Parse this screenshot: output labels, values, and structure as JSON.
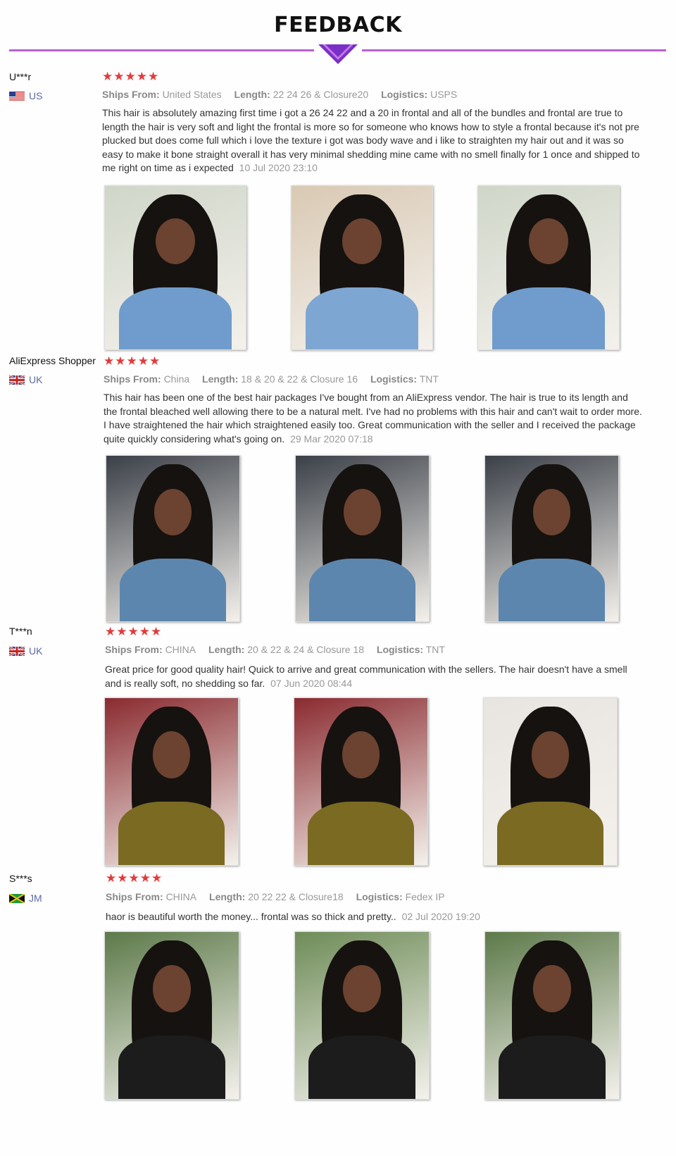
{
  "header": {
    "title": "FEEDBACK",
    "accent_color": "#b760d6",
    "arrow_color": "#7b2fc9"
  },
  "reviews": [
    {
      "user": "U***r",
      "country": "US",
      "flag": "us-flag-icon",
      "stars": "★★★★★",
      "ships_from_label": "Ships From:",
      "ships_from": "United States",
      "length_label": "Length:",
      "length": "22 24 26 & Closure20",
      "logistics_label": "Logistics:",
      "logistics": "USPS",
      "text": "This hair is absolutely amazing first time i got a 26 24 22 and a 20 in frontal and all of the bundles and frontal are true to length the hair is very soft and light the frontal is more so for someone who knows how to style a frontal because it's not pre plucked but does come full which i love the texture i got was body wave and i like to straighten my hair out and it was so easy to make it bone straight overall it has very minimal shedding mine came with no smell finally for 1 once and shipped to me right on time as i expected",
      "date": "10 Jul 2020 23:10",
      "photos": [
        {
          "icon": "customer-photo-icon",
          "bg": "#cfd6c8",
          "shirt": "#6f9ccc"
        },
        {
          "icon": "customer-photo-icon",
          "bg": "#d9c9b4",
          "shirt": "#7ea6d2"
        },
        {
          "icon": "customer-photo-icon",
          "bg": "#cfd6c8",
          "shirt": "#6f9ccc"
        }
      ]
    },
    {
      "user": "AliExpress Shopper",
      "country": "UK",
      "flag": "uk-flag-icon",
      "stars": "★★★★★",
      "ships_from_label": "Ships From:",
      "ships_from": "China",
      "length_label": "Length:",
      "length": "18 & 20 & 22 & Closure 16",
      "logistics_label": "Logistics:",
      "logistics": "TNT",
      "text": "This hair has been one of the best hair packages I've bought from an AliExpress vendor. The hair is true to its length and the frontal bleached well allowing there to be a natural melt. I've had no problems with this hair and can't wait to order more. I have straightened the hair which straightened easily too. Great communication with the seller and I received the package quite quickly considering what's going on.",
      "date": "29 Mar 2020 07:18",
      "photos": [
        {
          "icon": "customer-photo-icon",
          "bg": "#3b4048",
          "shirt": "#5c86ad"
        },
        {
          "icon": "customer-photo-icon",
          "bg": "#3b4048",
          "shirt": "#5c86ad"
        },
        {
          "icon": "customer-photo-icon",
          "bg": "#3b4048",
          "shirt": "#5c86ad"
        }
      ]
    },
    {
      "user": "T***n",
      "country": "UK",
      "flag": "uk-flag-icon",
      "stars": "★★★★★",
      "ships_from_label": "Ships From:",
      "ships_from": "CHINA",
      "length_label": "Length:",
      "length": "20 & 22 & 24 & Closure 18",
      "logistics_label": "Logistics:",
      "logistics": "TNT",
      "text": "Great price for good quality hair! Quick to arrive and great communication with the sellers. The hair doesn't have a smell and is really soft, no shedding so far.",
      "date": "07 Jun 2020 08:44",
      "photos": [
        {
          "icon": "customer-photo-icon",
          "bg": "#8a2b30",
          "shirt": "#7a6a22"
        },
        {
          "icon": "customer-photo-icon",
          "bg": "#8a2b30",
          "shirt": "#7a6a22"
        },
        {
          "icon": "customer-photo-icon",
          "bg": "#e8e4e0",
          "shirt": "#7a6a22"
        }
      ]
    },
    {
      "user": "S***s",
      "country": "JM",
      "flag": "jm-flag-icon",
      "stars": "★★★★★",
      "ships_from_label": "Ships From:",
      "ships_from": "CHINA",
      "length_label": "Length:",
      "length": "20 22 22 & Closure18",
      "logistics_label": "Logistics:",
      "logistics": "Fedex IP",
      "text": "haor is beautiful worth the money... frontal was so thick and pretty..",
      "date": "02 Jul 2020 19:20",
      "photos": [
        {
          "icon": "customer-photo-icon",
          "bg": "#5d7a4a",
          "shirt": "#1c1c1c"
        },
        {
          "icon": "customer-photo-icon",
          "bg": "#6e8c58",
          "shirt": "#1c1c1c"
        },
        {
          "icon": "customer-photo-icon",
          "bg": "#5d7a4a",
          "shirt": "#1c1c1c"
        }
      ]
    }
  ]
}
